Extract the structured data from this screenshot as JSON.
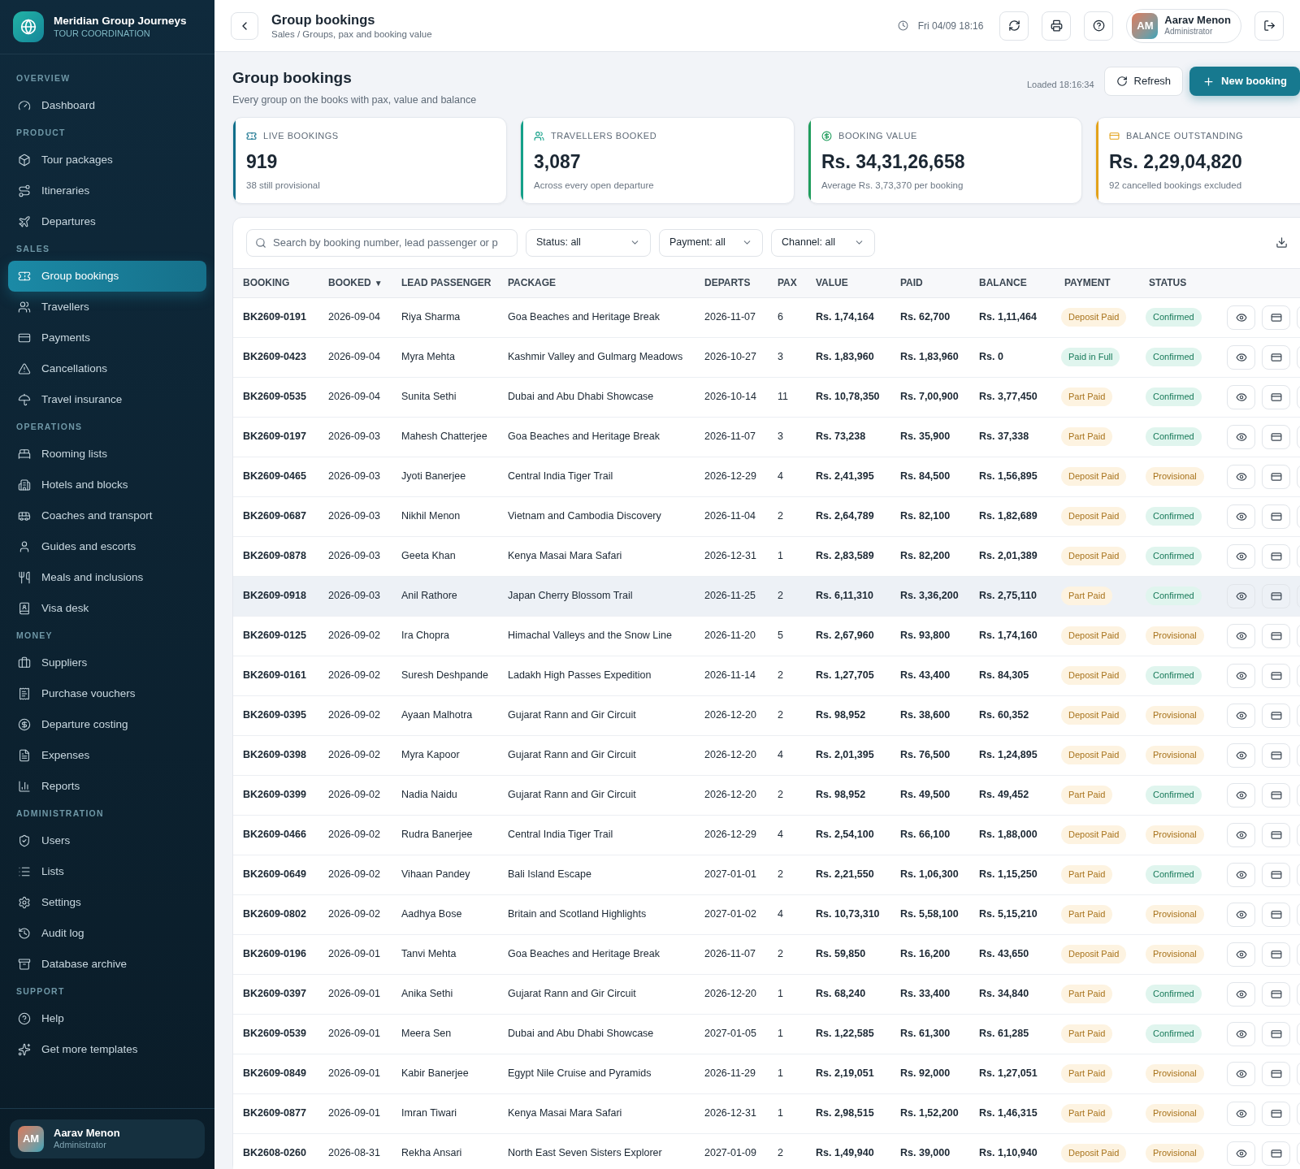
{
  "brand": {
    "name": "Meridian Group Journeys",
    "tagline": "TOUR COORDINATION"
  },
  "sidebar": {
    "sections": [
      {
        "title": "OVERVIEW",
        "items": [
          {
            "label": "Dashboard",
            "selected": false
          }
        ]
      },
      {
        "title": "PRODUCT",
        "items": [
          {
            "label": "Tour packages",
            "selected": false
          },
          {
            "label": "Itineraries",
            "selected": false
          },
          {
            "label": "Departures",
            "selected": false
          }
        ]
      },
      {
        "title": "SALES",
        "items": [
          {
            "label": "Group bookings",
            "selected": true
          },
          {
            "label": "Travellers",
            "selected": false
          },
          {
            "label": "Payments",
            "selected": false
          },
          {
            "label": "Cancellations",
            "selected": false
          },
          {
            "label": "Travel insurance",
            "selected": false
          }
        ]
      },
      {
        "title": "OPERATIONS",
        "items": [
          {
            "label": "Rooming lists",
            "selected": false
          },
          {
            "label": "Hotels and blocks",
            "selected": false
          },
          {
            "label": "Coaches and transport",
            "selected": false
          },
          {
            "label": "Guides and escorts",
            "selected": false
          },
          {
            "label": "Meals and inclusions",
            "selected": false
          },
          {
            "label": "Visa desk",
            "selected": false
          }
        ]
      },
      {
        "title": "MONEY",
        "items": [
          {
            "label": "Suppliers",
            "selected": false
          },
          {
            "label": "Purchase vouchers",
            "selected": false
          },
          {
            "label": "Departure costing",
            "selected": false
          },
          {
            "label": "Expenses",
            "selected": false
          },
          {
            "label": "Reports",
            "selected": false
          }
        ]
      },
      {
        "title": "ADMINISTRATION",
        "items": [
          {
            "label": "Users",
            "selected": false
          },
          {
            "label": "Lists",
            "selected": false
          },
          {
            "label": "Settings",
            "selected": false
          },
          {
            "label": "Audit log",
            "selected": false
          },
          {
            "label": "Database archive",
            "selected": false
          }
        ]
      },
      {
        "title": "SUPPORT",
        "items": [
          {
            "label": "Help",
            "selected": false
          },
          {
            "label": "Get more templates",
            "selected": false
          }
        ]
      }
    ],
    "user": {
      "initials": "AM",
      "name": "Aarav Menon",
      "role": "Administrator"
    }
  },
  "header": {
    "title": "Group bookings",
    "breadcrumb": "Sales / Groups, pax and booking value",
    "clock": "Fri 04/09 18:16",
    "user": {
      "initials": "AM",
      "name": "Aarav Menon",
      "role": "Administrator"
    }
  },
  "page": {
    "title": "Group bookings",
    "subtitle": "Every group on the books with pax, value and balance",
    "loaded": "Loaded 18:16:34",
    "refresh": "Refresh",
    "new_booking": "New booking"
  },
  "kpis": [
    {
      "label": "LIVE BOOKINGS",
      "value": "919",
      "note": "38 still provisional",
      "color": "#0e6e8a"
    },
    {
      "label": "TRAVELLERS BOOKED",
      "value": "3,087",
      "note": "Across every open departure",
      "color": "#14a088"
    },
    {
      "label": "BOOKING VALUE",
      "value": "Rs. 34,31,26,658",
      "note": "Average Rs. 3,73,370 per booking",
      "color": "#1f9d5c"
    },
    {
      "label": "BALANCE OUTSTANDING",
      "value": "Rs. 2,29,04,820",
      "note": "92 cancelled bookings excluded",
      "color": "#e3a21a"
    }
  ],
  "filters": {
    "search": {
      "placeholder": "Search by booking number, lead passenger or p"
    },
    "dropdowns": [
      "Status: all",
      "Payment: all",
      "Channel: all"
    ]
  },
  "table": {
    "columns": [
      {
        "label": "BOOKING"
      },
      {
        "label": "BOOKED",
        "sort_mark": "▼"
      },
      {
        "label": "LEAD PASSENGER"
      },
      {
        "label": "PACKAGE"
      },
      {
        "label": "DEPARTS"
      },
      {
        "label": "PAX"
      },
      {
        "label": "VALUE"
      },
      {
        "label": "PAID"
      },
      {
        "label": "BALANCE"
      },
      {
        "label": "PAYMENT"
      },
      {
        "label": "STATUS"
      }
    ],
    "rows": [
      {
        "booking": "BK2609-0191",
        "booked": "2026-09-04",
        "lead": "Riya Sharma",
        "package": "Goa Beaches and Heritage Break",
        "departs": "2026-11-07",
        "pax": "6",
        "value": "Rs. 1,74,164",
        "paid": "Rs. 62,700",
        "balance": "Rs. 1,11,464",
        "payment": {
          "text": "Deposit Paid",
          "kind": "pending"
        },
        "status": {
          "text": "Confirmed",
          "kind": "confirmed"
        },
        "hovered": false
      },
      {
        "booking": "BK2609-0423",
        "booked": "2026-09-04",
        "lead": "Myra Mehta",
        "package": "Kashmir Valley and Gulmarg Meadows",
        "departs": "2026-10-27",
        "pax": "3",
        "value": "Rs. 1,83,960",
        "paid": "Rs. 1,83,960",
        "balance": "Rs. 0",
        "payment": {
          "text": "Paid in Full",
          "kind": "settled"
        },
        "status": {
          "text": "Confirmed",
          "kind": "confirmed"
        },
        "hovered": false
      },
      {
        "booking": "BK2609-0535",
        "booked": "2026-09-04",
        "lead": "Sunita Sethi",
        "package": "Dubai and Abu Dhabi Showcase",
        "departs": "2026-10-14",
        "pax": "11",
        "value": "Rs. 10,78,350",
        "paid": "Rs. 7,00,900",
        "balance": "Rs. 3,77,450",
        "payment": {
          "text": "Part Paid",
          "kind": "pending"
        },
        "status": {
          "text": "Confirmed",
          "kind": "confirmed"
        },
        "hovered": false
      },
      {
        "booking": "BK2609-0197",
        "booked": "2026-09-03",
        "lead": "Mahesh Chatterjee",
        "package": "Goa Beaches and Heritage Break",
        "departs": "2026-11-07",
        "pax": "3",
        "value": "Rs. 73,238",
        "paid": "Rs. 35,900",
        "balance": "Rs. 37,338",
        "payment": {
          "text": "Part Paid",
          "kind": "pending"
        },
        "status": {
          "text": "Confirmed",
          "kind": "confirmed"
        },
        "hovered": false
      },
      {
        "booking": "BK2609-0465",
        "booked": "2026-09-03",
        "lead": "Jyoti Banerjee",
        "package": "Central India Tiger Trail",
        "departs": "2026-12-29",
        "pax": "4",
        "value": "Rs. 2,41,395",
        "paid": "Rs. 84,500",
        "balance": "Rs. 1,56,895",
        "payment": {
          "text": "Deposit Paid",
          "kind": "pending"
        },
        "status": {
          "text": "Provisional",
          "kind": "provisional"
        },
        "hovered": false
      },
      {
        "booking": "BK2609-0687",
        "booked": "2026-09-03",
        "lead": "Nikhil Menon",
        "package": "Vietnam and Cambodia Discovery",
        "departs": "2026-11-04",
        "pax": "2",
        "value": "Rs. 2,64,789",
        "paid": "Rs. 82,100",
        "balance": "Rs. 1,82,689",
        "payment": {
          "text": "Deposit Paid",
          "kind": "pending"
        },
        "status": {
          "text": "Confirmed",
          "kind": "confirmed"
        },
        "hovered": false
      },
      {
        "booking": "BK2609-0878",
        "booked": "2026-09-03",
        "lead": "Geeta Khan",
        "package": "Kenya Masai Mara Safari",
        "departs": "2026-12-31",
        "pax": "1",
        "value": "Rs. 2,83,589",
        "paid": "Rs. 82,200",
        "balance": "Rs. 2,01,389",
        "payment": {
          "text": "Deposit Paid",
          "kind": "pending"
        },
        "status": {
          "text": "Confirmed",
          "kind": "confirmed"
        },
        "hovered": false
      },
      {
        "booking": "BK2609-0918",
        "booked": "2026-09-03",
        "lead": "Anil Rathore",
        "package": "Japan Cherry Blossom Trail",
        "departs": "2026-11-25",
        "pax": "2",
        "value": "Rs. 6,11,310",
        "paid": "Rs. 3,36,200",
        "balance": "Rs. 2,75,110",
        "payment": {
          "text": "Part Paid",
          "kind": "pending"
        },
        "status": {
          "text": "Confirmed",
          "kind": "confirmed"
        },
        "hovered": true
      },
      {
        "booking": "BK2609-0125",
        "booked": "2026-09-02",
        "lead": "Ira Chopra",
        "package": "Himachal Valleys and the Snow Line",
        "departs": "2026-11-20",
        "pax": "5",
        "value": "Rs. 2,67,960",
        "paid": "Rs. 93,800",
        "balance": "Rs. 1,74,160",
        "payment": {
          "text": "Deposit Paid",
          "kind": "pending"
        },
        "status": {
          "text": "Provisional",
          "kind": "provisional"
        },
        "hovered": false
      },
      {
        "booking": "BK2609-0161",
        "booked": "2026-09-02",
        "lead": "Suresh Deshpande",
        "package": "Ladakh High Passes Expedition",
        "departs": "2026-11-14",
        "pax": "2",
        "value": "Rs. 1,27,705",
        "paid": "Rs. 43,400",
        "balance": "Rs. 84,305",
        "payment": {
          "text": "Deposit Paid",
          "kind": "pending"
        },
        "status": {
          "text": "Confirmed",
          "kind": "confirmed"
        },
        "hovered": false
      },
      {
        "booking": "BK2609-0395",
        "booked": "2026-09-02",
        "lead": "Ayaan Malhotra",
        "package": "Gujarat Rann and Gir Circuit",
        "departs": "2026-12-20",
        "pax": "2",
        "value": "Rs. 98,952",
        "paid": "Rs. 38,600",
        "balance": "Rs. 60,352",
        "payment": {
          "text": "Deposit Paid",
          "kind": "pending"
        },
        "status": {
          "text": "Provisional",
          "kind": "provisional"
        },
        "hovered": false
      },
      {
        "booking": "BK2609-0398",
        "booked": "2026-09-02",
        "lead": "Myra Kapoor",
        "package": "Gujarat Rann and Gir Circuit",
        "departs": "2026-12-20",
        "pax": "4",
        "value": "Rs. 2,01,395",
        "paid": "Rs. 76,500",
        "balance": "Rs. 1,24,895",
        "payment": {
          "text": "Deposit Paid",
          "kind": "pending"
        },
        "status": {
          "text": "Provisional",
          "kind": "provisional"
        },
        "hovered": false
      },
      {
        "booking": "BK2609-0399",
        "booked": "2026-09-02",
        "lead": "Nadia Naidu",
        "package": "Gujarat Rann and Gir Circuit",
        "departs": "2026-12-20",
        "pax": "2",
        "value": "Rs. 98,952",
        "paid": "Rs. 49,500",
        "balance": "Rs. 49,452",
        "payment": {
          "text": "Part Paid",
          "kind": "pending"
        },
        "status": {
          "text": "Confirmed",
          "kind": "confirmed"
        },
        "hovered": false
      },
      {
        "booking": "BK2609-0466",
        "booked": "2026-09-02",
        "lead": "Rudra Banerjee",
        "package": "Central India Tiger Trail",
        "departs": "2026-12-29",
        "pax": "4",
        "value": "Rs. 2,54,100",
        "paid": "Rs. 66,100",
        "balance": "Rs. 1,88,000",
        "payment": {
          "text": "Deposit Paid",
          "kind": "pending"
        },
        "status": {
          "text": "Provisional",
          "kind": "provisional"
        },
        "hovered": false
      },
      {
        "booking": "BK2609-0649",
        "booked": "2026-09-02",
        "lead": "Vihaan Pandey",
        "package": "Bali Island Escape",
        "departs": "2027-01-01",
        "pax": "2",
        "value": "Rs. 2,21,550",
        "paid": "Rs. 1,06,300",
        "balance": "Rs. 1,15,250",
        "payment": {
          "text": "Part Paid",
          "kind": "pending"
        },
        "status": {
          "text": "Confirmed",
          "kind": "confirmed"
        },
        "hovered": false
      },
      {
        "booking": "BK2609-0802",
        "booked": "2026-09-02",
        "lead": "Aadhya Bose",
        "package": "Britain and Scotland Highlights",
        "departs": "2027-01-02",
        "pax": "4",
        "value": "Rs. 10,73,310",
        "paid": "Rs. 5,58,100",
        "balance": "Rs. 5,15,210",
        "payment": {
          "text": "Part Paid",
          "kind": "pending"
        },
        "status": {
          "text": "Provisional",
          "kind": "provisional"
        },
        "hovered": false
      },
      {
        "booking": "BK2609-0196",
        "booked": "2026-09-01",
        "lead": "Tanvi Mehta",
        "package": "Goa Beaches and Heritage Break",
        "departs": "2026-11-07",
        "pax": "2",
        "value": "Rs. 59,850",
        "paid": "Rs. 16,200",
        "balance": "Rs. 43,650",
        "payment": {
          "text": "Deposit Paid",
          "kind": "pending"
        },
        "status": {
          "text": "Provisional",
          "kind": "provisional"
        },
        "hovered": false
      },
      {
        "booking": "BK2609-0397",
        "booked": "2026-09-01",
        "lead": "Anika Sethi",
        "package": "Gujarat Rann and Gir Circuit",
        "departs": "2026-12-20",
        "pax": "1",
        "value": "Rs. 68,240",
        "paid": "Rs. 33,400",
        "balance": "Rs. 34,840",
        "payment": {
          "text": "Part Paid",
          "kind": "pending"
        },
        "status": {
          "text": "Confirmed",
          "kind": "confirmed"
        },
        "hovered": false
      },
      {
        "booking": "BK2609-0539",
        "booked": "2026-09-01",
        "lead": "Meera Sen",
        "package": "Dubai and Abu Dhabi Showcase",
        "departs": "2027-01-05",
        "pax": "1",
        "value": "Rs. 1,22,585",
        "paid": "Rs. 61,300",
        "balance": "Rs. 61,285",
        "payment": {
          "text": "Part Paid",
          "kind": "pending"
        },
        "status": {
          "text": "Confirmed",
          "kind": "confirmed"
        },
        "hovered": false
      },
      {
        "booking": "BK2609-0849",
        "booked": "2026-09-01",
        "lead": "Kabir Banerjee",
        "package": "Egypt Nile Cruise and Pyramids",
        "departs": "2026-11-29",
        "pax": "1",
        "value": "Rs. 2,19,051",
        "paid": "Rs. 92,000",
        "balance": "Rs. 1,27,051",
        "payment": {
          "text": "Part Paid",
          "kind": "pending"
        },
        "status": {
          "text": "Provisional",
          "kind": "provisional"
        },
        "hovered": false
      },
      {
        "booking": "BK2609-0877",
        "booked": "2026-09-01",
        "lead": "Imran Tiwari",
        "package": "Kenya Masai Mara Safari",
        "departs": "2026-12-31",
        "pax": "1",
        "value": "Rs. 2,98,515",
        "paid": "Rs. 1,52,200",
        "balance": "Rs. 1,46,315",
        "payment": {
          "text": "Part Paid",
          "kind": "pending"
        },
        "status": {
          "text": "Provisional",
          "kind": "provisional"
        },
        "hovered": false
      },
      {
        "booking": "BK2608-0260",
        "booked": "2026-08-31",
        "lead": "Rekha Ansari",
        "package": "North East Seven Sisters Explorer",
        "departs": "2027-01-09",
        "pax": "2",
        "value": "Rs. 1,49,940",
        "paid": "Rs. 39,000",
        "balance": "Rs. 1,10,940",
        "payment": {
          "text": "Deposit Paid",
          "kind": "pending"
        },
        "status": {
          "text": "Provisional",
          "kind": "provisional"
        },
        "hovered": false
      }
    ]
  }
}
